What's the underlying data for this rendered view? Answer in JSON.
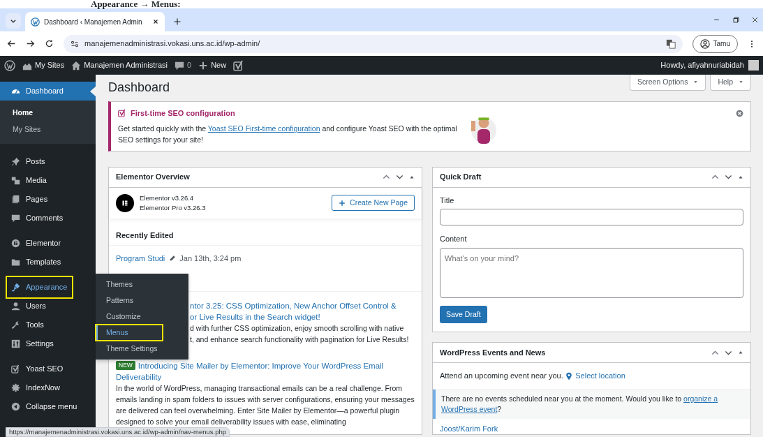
{
  "doc_heading": "Appearance → Menus:",
  "browser": {
    "tabs": [
      {
        "title": "Dashboard ‹ Manajemen Admin",
        "selected": true
      }
    ],
    "url": "manajemenadministrasi.vokasi.uns.ac.id/wp-admin/",
    "profile": "Tamu"
  },
  "admin_bar": {
    "items": [
      {
        "kind": "wp"
      },
      {
        "kind": "sites",
        "label": "My Sites"
      },
      {
        "kind": "home",
        "label": "Manajemen Administrasi"
      },
      {
        "kind": "comments",
        "label": "0"
      },
      {
        "kind": "new",
        "label": "New"
      },
      {
        "kind": "yoast"
      }
    ],
    "greeting": "Howdy, afiyahnuriabidah"
  },
  "sidebar": {
    "groups": [
      {
        "items": [
          {
            "label": "Dashboard",
            "kind": "gauge",
            "selected": true,
            "hovered": false,
            "annotated": false,
            "children": [
              {
                "label": "Home",
                "selected": true
              },
              {
                "label": "My Sites",
                "selected": false
              }
            ]
          }
        ]
      },
      {
        "items": [
          {
            "label": "Posts",
            "kind": "pin",
            "selected": false,
            "hovered": false,
            "annotated": false
          },
          {
            "label": "Media",
            "kind": "media",
            "selected": false,
            "hovered": false,
            "annotated": false
          },
          {
            "label": "Pages",
            "kind": "pages",
            "selected": false,
            "hovered": false,
            "annotated": false
          },
          {
            "label": "Comments",
            "kind": "bubble",
            "selected": false,
            "hovered": false,
            "annotated": false
          }
        ]
      },
      {
        "items": [
          {
            "label": "Elementor",
            "kind": "elementor",
            "selected": false,
            "hovered": false,
            "annotated": false
          },
          {
            "label": "Templates",
            "kind": "folder",
            "selected": false,
            "hovered": false,
            "annotated": false
          }
        ]
      },
      {
        "items": [
          {
            "label": "Appearance",
            "kind": "brush",
            "selected": false,
            "hovered": true,
            "annotated": true
          },
          {
            "label": "Users",
            "kind": "user",
            "selected": false,
            "hovered": false,
            "annotated": false
          },
          {
            "label": "Tools",
            "kind": "wrench",
            "selected": false,
            "hovered": false,
            "annotated": false
          },
          {
            "label": "Settings",
            "kind": "sliders",
            "selected": false,
            "hovered": false,
            "annotated": false
          }
        ]
      },
      {
        "items": [
          {
            "label": "Yoast SEO",
            "kind": "yoast",
            "selected": false,
            "hovered": false,
            "annotated": false
          },
          {
            "label": "IndexNow",
            "kind": "cog",
            "selected": false,
            "hovered": false,
            "annotated": false
          },
          {
            "label": "Collapse menu",
            "kind": "collapse",
            "selected": false,
            "hovered": false,
            "annotated": false
          }
        ]
      }
    ]
  },
  "flyout": {
    "items": [
      {
        "label": "Themes",
        "selected": false,
        "annotated": false
      },
      {
        "label": "Patterns",
        "selected": false,
        "annotated": false
      },
      {
        "label": "Customize",
        "selected": false,
        "annotated": false
      },
      {
        "label": "Menus",
        "selected": true,
        "annotated": true
      },
      {
        "label": "Theme Settings",
        "selected": false,
        "annotated": false
      }
    ]
  },
  "page": {
    "title": "Dashboard",
    "buttons": [
      "Screen Options",
      "Help"
    ]
  },
  "notice": {
    "title": "First-time SEO configuration",
    "text_before": "Get started quickly with the ",
    "link": "Yoast SEO First-time configuration",
    "text_after": " and configure Yoast SEO with the optimal SEO settings for your site!"
  },
  "elementor": {
    "title": "Elementor Overview",
    "versions": [
      "Elementor v3.26.4",
      "Elementor Pro v3.26.3"
    ],
    "button": "Create New Page",
    "recent_heading": "Recently Edited",
    "recent": [
      {
        "title": "Program Studi",
        "date": "Jan 13th, 3:24 pm"
      }
    ],
    "news": [
      {
        "partly_hidden": true,
        "title_lines": [
          "ntor 3.25: CSS Optimization, New Anchor Offset Control &",
          "or Live Results in the Search widget!"
        ],
        "excerpt_lines": [
          "d with further CSS optimization, enjoy smooth scrolling with native",
          "t, and enhance search functionality with pagination for Live Results!"
        ]
      },
      {
        "partly_hidden": false,
        "badge": "NEW",
        "title_lines": [
          "Introducing Site Mailer by Elementor: Improve Your WordPress Email",
          "Deliverability"
        ],
        "excerpt_lines": [
          "In the world of WordPress, managing transactional emails can be a real challenge. From emails landing in spam folders to issues with server configurations, ensuring your messages are delivered can feel overwhelming. Enter Site Mailer by Elementor—a powerful plugin designed to solve your email deliverability issues with ease, eliminating"
        ]
      }
    ]
  },
  "quick_draft": {
    "title": "Quick Draft",
    "title_label": "Title",
    "content_label": "Content",
    "placeholder": "What's on your mind?",
    "button": "Save Draft"
  },
  "events": {
    "title": "WordPress Events and News",
    "attend": "Attend an upcoming event near you.",
    "location_link": "Select location",
    "notice_before": "There are no events scheduled near you at the moment. Would you like to ",
    "notice_link_lines": [
      "organize a",
      "WordPress event"
    ],
    "notice_after": "?",
    "news": [
      "Joost/Karim Fork"
    ]
  },
  "status_url": "https://manajemenadministrasi.vokasi.uns.ac.id/wp-admin/nav-menus.php"
}
